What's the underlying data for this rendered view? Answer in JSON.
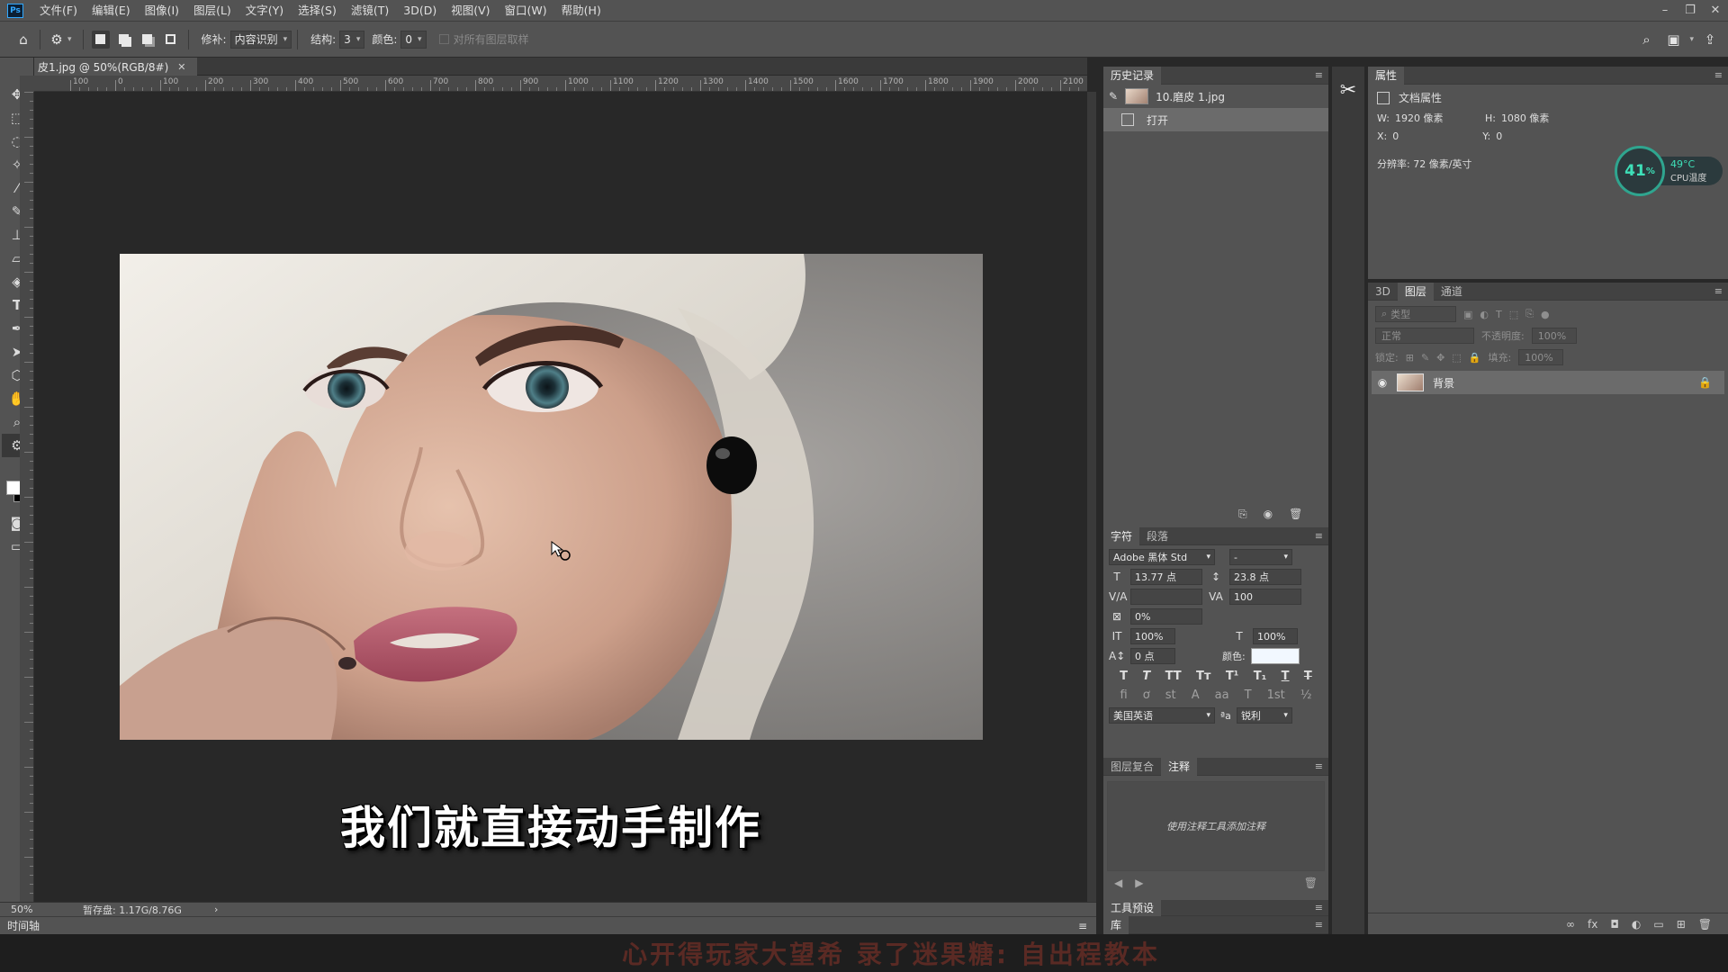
{
  "menu": {
    "items": [
      "文件(F)",
      "编辑(E)",
      "图像(I)",
      "图层(L)",
      "文字(Y)",
      "选择(S)",
      "滤镜(T)",
      "3D(D)",
      "视图(V)",
      "窗口(W)",
      "帮助(H)"
    ],
    "logo": "Ps"
  },
  "options": {
    "repair_label": "修补:",
    "repair_value": "内容识别",
    "structure_label": "结构:",
    "structure_value": "3",
    "color_label": "颜色:",
    "color_value": "0",
    "sample_all_label": "对所有图层取样"
  },
  "document": {
    "tab_title": "皮1.jpg @ 50%(RGB/8#)",
    "ruler_labels": [
      "100",
      "0",
      "100",
      "200",
      "300",
      "400",
      "500",
      "600",
      "700",
      "800",
      "900",
      "1000",
      "1100",
      "1200",
      "1300",
      "1400",
      "1500",
      "1600",
      "1700",
      "1800",
      "1900",
      "2000",
      "2100"
    ],
    "caption": "我们就直接动手制作"
  },
  "status": {
    "zoom": "50%",
    "scratch": "暂存盘: 1.17G/8.76G",
    "timeline": "时间轴"
  },
  "history": {
    "title": "历史记录",
    "snapshot_label": "10.磨皮 1.jpg",
    "step_label": "打开"
  },
  "character": {
    "tab_char": "字符",
    "tab_para": "段落",
    "font_family": "Adobe 黑体 Std",
    "font_style": "-",
    "font_size": "13.77 点",
    "leading": "23.8 点",
    "kerning": "",
    "tracking": "100",
    "scale_pct": "0%",
    "vert_scale": "100%",
    "horiz_scale": "100%",
    "baseline": "0 点",
    "color_label": "颜色:",
    "language": "美国英语",
    "aa_label": "ªa",
    "antialias": "锐利"
  },
  "notes": {
    "tab_comps": "图层复合",
    "tab_notes": "注释",
    "placeholder": "使用注释工具添加注释"
  },
  "panels": {
    "tool_presets": "工具预设",
    "library": "库"
  },
  "properties": {
    "title": "属性",
    "doc_props": "文档属性",
    "w_label": "W:",
    "w_value": "1920 像素",
    "h_label": "H:",
    "h_value": "1080 像素",
    "x_label": "X:",
    "x_value": "0",
    "y_label": "Y:",
    "y_value": "0",
    "resolution": "分辨率: 72 像素/英寸"
  },
  "cpu": {
    "percent": "41",
    "unit": "%",
    "temp": "49°C",
    "label": "CPU温度"
  },
  "layers": {
    "tab_3d": "3D",
    "tab_layers": "图层",
    "tab_channels": "通道",
    "filter_placeholder": "类型",
    "blend_mode": "正常",
    "opacity_label": "不透明度:",
    "opacity_value": "100%",
    "lock_label": "锁定:",
    "fill_label": "填充:",
    "fill_value": "100%",
    "layer_name": "背景"
  },
  "watermark": "心开得玩家大望希 录了迷果糖: 自出程教本",
  "colors": {
    "panel": "#535353",
    "canvas": "#282828",
    "accent": "#31a8ff",
    "cpu": "#2fa58f"
  }
}
